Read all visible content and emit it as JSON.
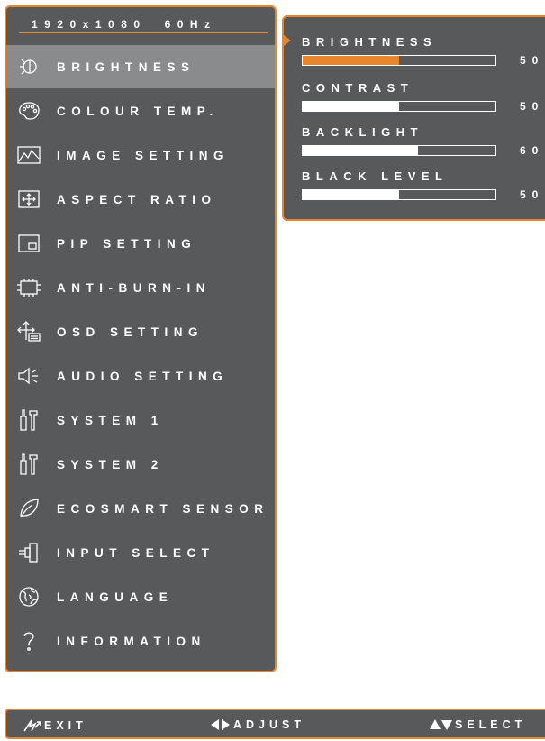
{
  "resolution": {
    "size": "1920x1080",
    "refresh": "60Hz"
  },
  "menu": {
    "items": [
      {
        "label": "BRIGHTNESS",
        "icon": "brightness-icon",
        "selected": true
      },
      {
        "label": "COLOUR TEMP.",
        "icon": "palette-icon"
      },
      {
        "label": "IMAGE SETTING",
        "icon": "image-icon"
      },
      {
        "label": "ASPECT RATIO",
        "icon": "aspect-ratio-icon"
      },
      {
        "label": "PIP SETTING",
        "icon": "pip-icon"
      },
      {
        "label": "ANTI-BURN-IN",
        "icon": "chip-icon"
      },
      {
        "label": "OSD SETTING",
        "icon": "osd-icon"
      },
      {
        "label": "AUDIO SETTING",
        "icon": "speaker-icon"
      },
      {
        "label": "SYSTEM 1",
        "icon": "tools-icon"
      },
      {
        "label": "SYSTEM 2",
        "icon": "tools-icon"
      },
      {
        "label": "ECOSMART SENSOR",
        "icon": "leaf-icon"
      },
      {
        "label": "INPUT SELECT",
        "icon": "plug-icon"
      },
      {
        "label": "LANGUAGE",
        "icon": "globe-icon"
      },
      {
        "label": "INFORMATION",
        "icon": "question-icon"
      }
    ]
  },
  "submenu": {
    "items": [
      {
        "label": "BRIGHTNESS",
        "value": 50,
        "value_text": "50",
        "active": true
      },
      {
        "label": "CONTRAST",
        "value": 50,
        "value_text": "50"
      },
      {
        "label": "BACKLIGHT",
        "value": 60,
        "value_text": "60"
      },
      {
        "label": "BLACK LEVEL",
        "value": 50,
        "value_text": "50"
      }
    ]
  },
  "footer": {
    "exit_label": "EXIT",
    "adjust_label": "ADJUST",
    "select_label": "SELECT"
  },
  "colors": {
    "accent": "#e8862e",
    "panel": "#58595b",
    "highlight": "#8a8b8c"
  }
}
